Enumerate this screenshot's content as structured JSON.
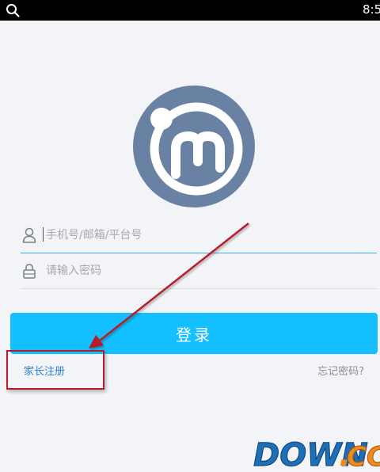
{
  "status_bar": {
    "time": "8:5",
    "search_icon": "search-icon"
  },
  "logo": {
    "icon": "app-logo-icon",
    "circle_color": "#6981a2"
  },
  "form": {
    "username": {
      "icon": "user-icon",
      "placeholder": "手机号/邮箱/平台号",
      "value": ""
    },
    "password": {
      "icon": "lock-icon",
      "placeholder": "请输入密码",
      "value": ""
    },
    "login_label": "登录",
    "register_label": "家长注册",
    "forgot_label": "忘记密码?"
  },
  "colors": {
    "background": "#f3f4f8",
    "login_button": "#14c0ff",
    "register_link": "#2f7fd8",
    "annotation": "#b81a25"
  },
  "watermark": {
    "text_main": "DOWN",
    "text_dot": ".",
    "text_suffix": "CC"
  }
}
